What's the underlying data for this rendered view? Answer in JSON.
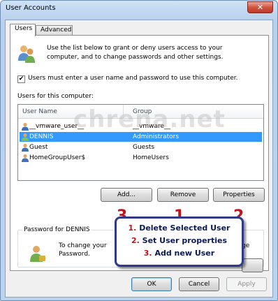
{
  "window": {
    "title": "User Accounts",
    "close_glyph": "✕"
  },
  "tabs": [
    {
      "label": "Users",
      "active": true
    },
    {
      "label": "Advanced",
      "active": false
    }
  ],
  "intro": {
    "text": "Use the list below to grant or deny users access to your computer, and to change passwords and other settings."
  },
  "require_login": {
    "checked": true,
    "check_glyph": "✔",
    "label": "Users must enter a user name and password to use this computer."
  },
  "users": {
    "caption": "Users for this computer:",
    "columns": [
      "User Name",
      "Group"
    ],
    "rows": [
      {
        "name": "__vmware_user__",
        "group": "__vmware__",
        "selected": false
      },
      {
        "name": "DENNIS",
        "group": "Administrators",
        "selected": true
      },
      {
        "name": "Guest",
        "group": "Guests",
        "selected": false
      },
      {
        "name": "HomeGroupUser$",
        "group": "HomeUsers",
        "selected": false
      }
    ],
    "watermark": "chrena.net"
  },
  "list_buttons": {
    "add": "Add...",
    "remove": "Remove",
    "properties": "Properties"
  },
  "markers": {
    "add": "3",
    "remove": "1",
    "properties": "2"
  },
  "password": {
    "title": "Password for DENNIS",
    "text_left": "To change your pas",
    "text_left2": "Password.",
    "text_right": "ge"
  },
  "callout": {
    "line1_num": "1.",
    "line1_text": " Delete Selected User",
    "line2_num": "2.",
    "line2_text": " Set User properties",
    "line3_num": "3.",
    "line3_text": " Add new User"
  },
  "dialog_buttons": {
    "ok": "OK",
    "cancel": "Cancel",
    "apply": "Apply"
  },
  "colors": {
    "selection": "#3399ff",
    "marker_red": "#c0141a",
    "callout_border": "#303a8a"
  }
}
